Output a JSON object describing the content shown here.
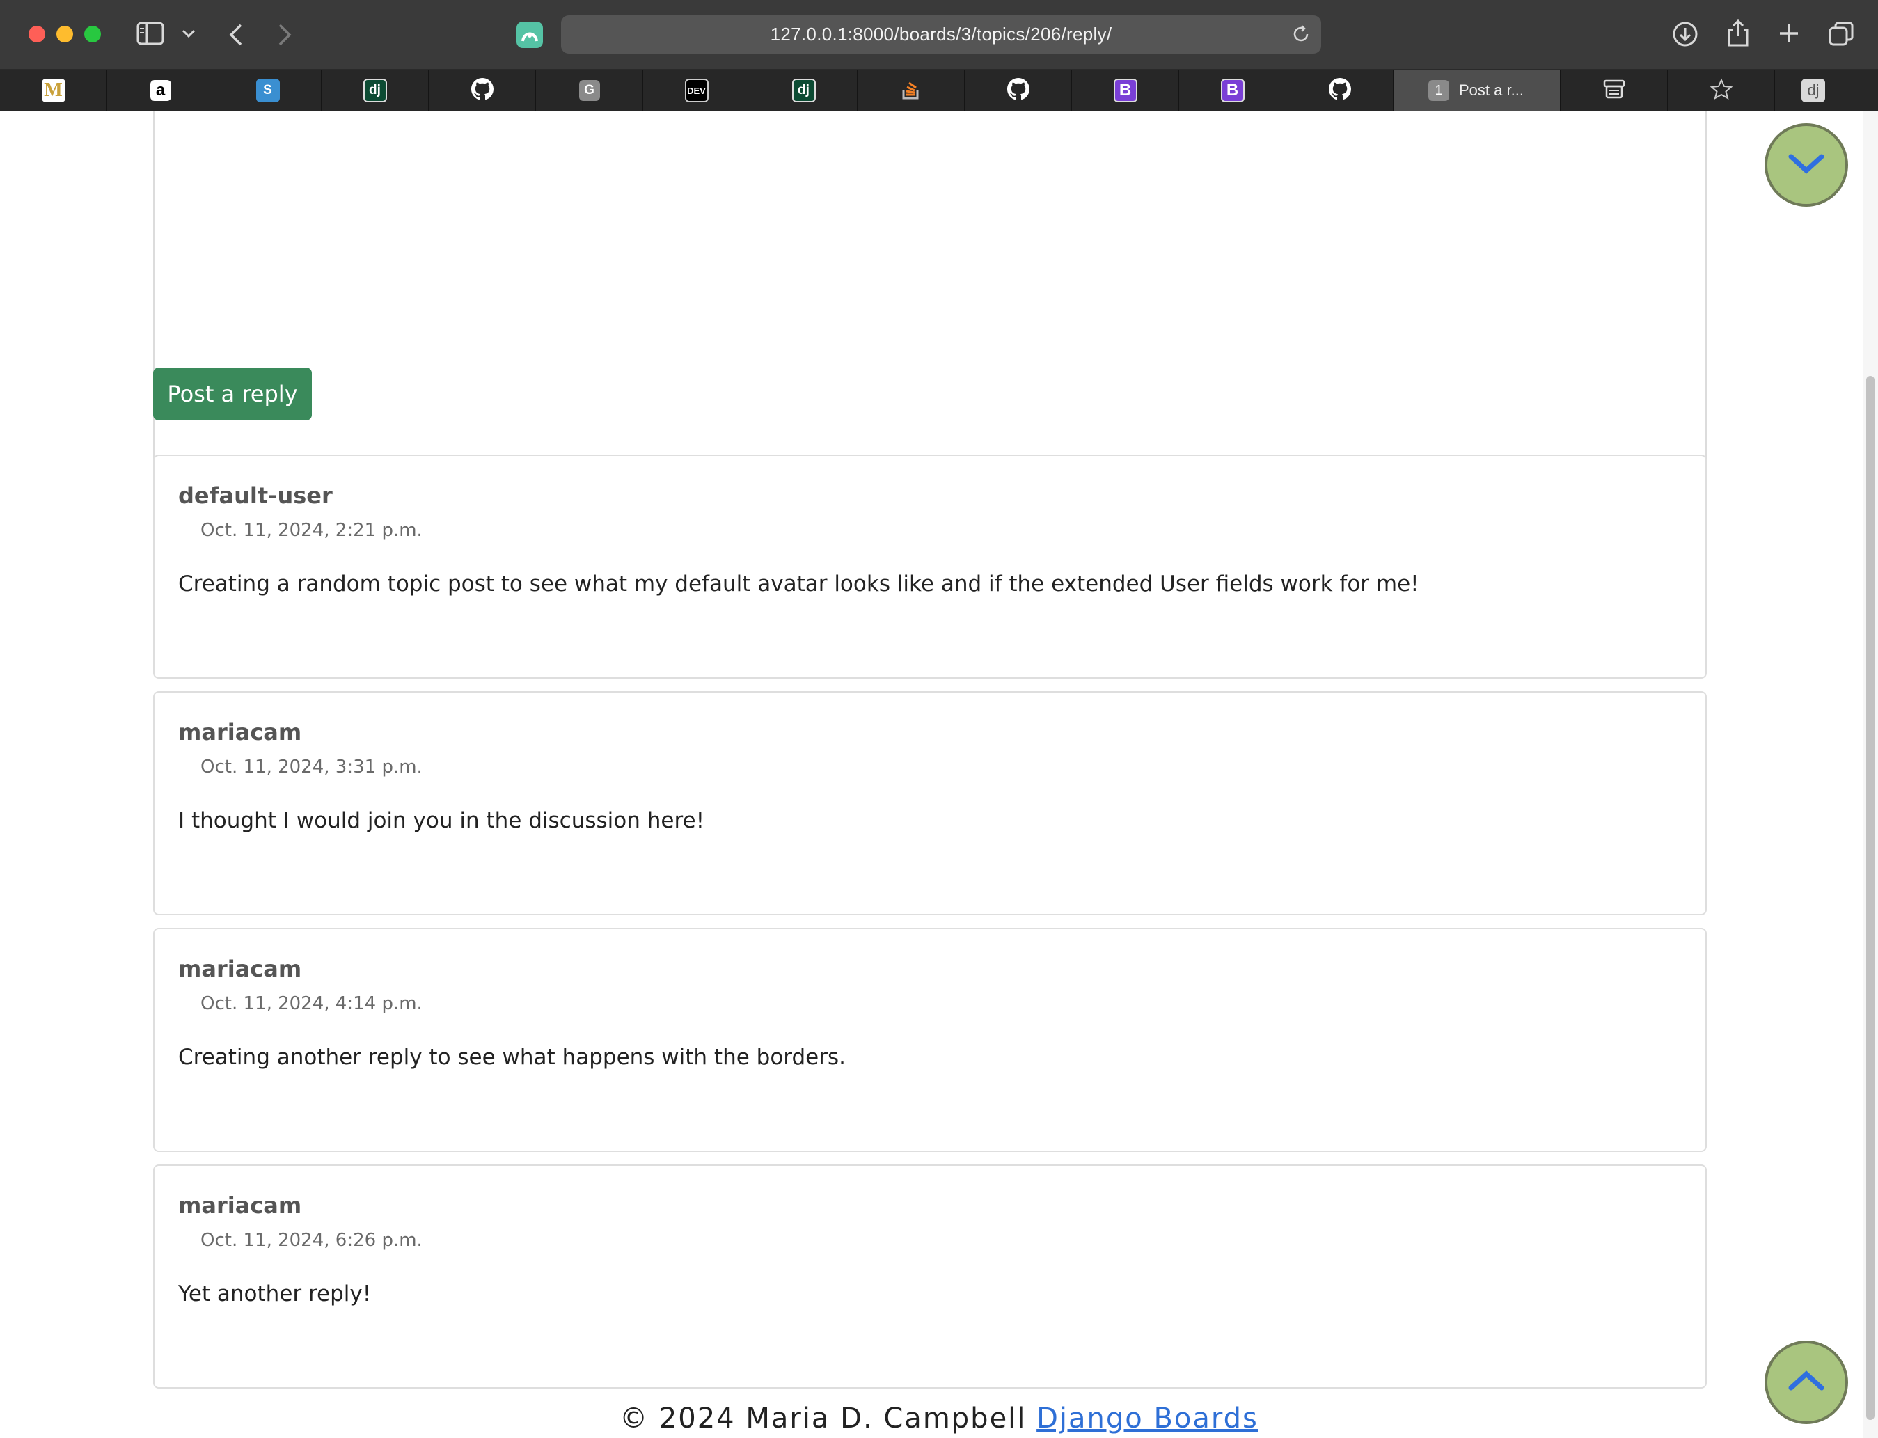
{
  "browser": {
    "url": "127.0.0.1:8000/boards/3/topics/206/reply/",
    "tabs": [
      {
        "icon": "M",
        "fg": "#e0b23a",
        "bg": "#ffffff"
      },
      {
        "icon": "a",
        "fg": "#000000",
        "bg": "#ffffff"
      },
      {
        "icon": "S",
        "fg": "#ffffff",
        "bg": "#3a8fd1"
      },
      {
        "icon": "dj",
        "fg": "#ffffff",
        "bg": "#0c4b33"
      },
      {
        "icon": "github-icon",
        "fg": "#ffffff",
        "bg": "transparent"
      },
      {
        "icon": "G",
        "fg": "#ffffff",
        "bg": "#8a8a8a"
      },
      {
        "icon": "DEV",
        "fg": "#ffffff",
        "bg": "#000000"
      },
      {
        "icon": "dj",
        "fg": "#ffffff",
        "bg": "#0c4b33"
      },
      {
        "icon": "stackoverflow-icon",
        "fg": "#f48024",
        "bg": "transparent"
      },
      {
        "icon": "github-icon",
        "fg": "#ffffff",
        "bg": "transparent"
      },
      {
        "icon": "B",
        "fg": "#ffffff",
        "bg": "#7a3fd6"
      },
      {
        "icon": "B",
        "fg": "#ffffff",
        "bg": "#7a3fd6"
      },
      {
        "icon": "github-icon",
        "fg": "#ffffff",
        "bg": "transparent"
      }
    ],
    "active_tab": {
      "badge": "1",
      "label": "Post a r..."
    },
    "trailing_tabs": [
      {
        "icon": "ticket-icon"
      },
      {
        "icon": "star-icon"
      },
      {
        "icon": "dj",
        "fg": "#333333",
        "bg": "#d9d9d9"
      }
    ]
  },
  "reply_form": {
    "submit_label": "Post a reply"
  },
  "posts": [
    {
      "author": "default-user",
      "date": "Oct. 11, 2024, 2:21 p.m.",
      "body": "Creating a random topic post to see what my default avatar looks like and if the extended User fields work for me!"
    },
    {
      "author": "mariacam",
      "date": "Oct. 11, 2024, 3:31 p.m.",
      "body": "I thought I would join you in the discussion here!"
    },
    {
      "author": "mariacam",
      "date": "Oct. 11, 2024, 4:14 p.m.",
      "body": "Creating another reply to see what happens with the borders."
    },
    {
      "author": "mariacam",
      "date": "Oct. 11, 2024, 6:26 p.m.",
      "body": "Yet another reply!"
    }
  ],
  "footer": {
    "copyright": "© 2024 Maria D. Campbell",
    "link_label": "Django Boards"
  },
  "colors": {
    "button_green": "#3a8a5b",
    "float_button": "#a9c57f",
    "chevron_blue": "#2f6fe0",
    "link_blue": "#2e6fd6"
  }
}
